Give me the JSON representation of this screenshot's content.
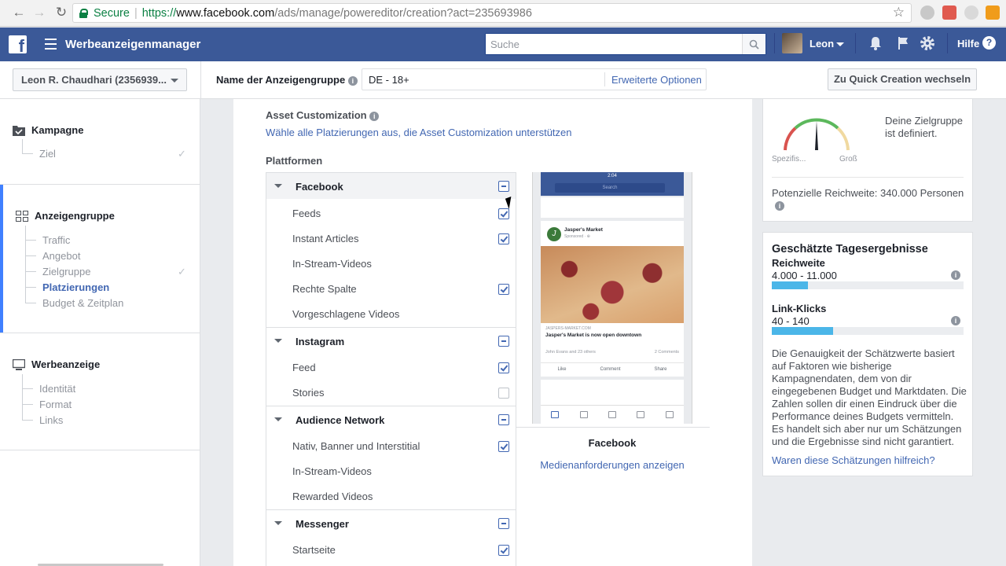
{
  "browser": {
    "secure_label": "Secure",
    "url_scheme": "https://",
    "url_host": "www.facebook.com",
    "url_path": "/ads/manage/powereditor/creation?act=235693986"
  },
  "topbar": {
    "logo": "f",
    "app_title": "Werbeanzeigenmanager",
    "search_placeholder": "Suche",
    "user_name": "Leon",
    "help_label": "Hilfe",
    "help_icon": "?"
  },
  "subheader": {
    "account": "Leon R. Chaudhari (2356939...",
    "adset_name_label": "Name der Anzeigengruppe",
    "adset_name_value": "DE - 18+",
    "advanced_options": "Erweiterte Optionen",
    "quick_creation": "Zu Quick Creation wechseln"
  },
  "sidebar": {
    "campaign": {
      "title": "Kampagne",
      "items": [
        "Ziel"
      ]
    },
    "adset": {
      "title": "Anzeigengruppe",
      "items": [
        "Traffic",
        "Angebot",
        "Zielgruppe",
        "Platzierungen",
        "Budget & Zeitplan"
      ]
    },
    "ad": {
      "title": "Werbeanzeige",
      "items": [
        "Identität",
        "Format",
        "Links"
      ]
    },
    "check": "✓"
  },
  "main": {
    "asset_customization_title": "Asset Customization",
    "asset_customization_link": "Wähle alle Platzierungen aus, die Asset Customization unterstützen",
    "platforms_title": "Plattformen",
    "groups": [
      {
        "label": "Facebook",
        "items": [
          {
            "label": "Feeds",
            "checked": true
          },
          {
            "label": "Instant Articles",
            "checked": true
          },
          {
            "label": "In-Stream-Videos",
            "checked": false
          },
          {
            "label": "Rechte Spalte",
            "checked": true
          },
          {
            "label": "Vorgeschlagene Videos",
            "checked": false
          }
        ]
      },
      {
        "label": "Instagram",
        "items": [
          {
            "label": "Feed",
            "checked": true
          },
          {
            "label": "Stories",
            "checked": false
          }
        ]
      },
      {
        "label": "Audience Network",
        "items": [
          {
            "label": "Nativ, Banner und Interstitial",
            "checked": true
          },
          {
            "label": "In-Stream-Videos",
            "checked": false
          },
          {
            "label": "Rewarded Videos",
            "checked": false
          }
        ]
      },
      {
        "label": "Messenger",
        "items": [
          {
            "label": "Startseite",
            "checked": true
          }
        ]
      }
    ],
    "preview": {
      "status_time": "2:04",
      "search": "Search",
      "page_name": "Jasper's Market",
      "sponsored": "Sponsored · ⊕",
      "domain": "JASPERS-MARKET.COM",
      "headline": "Jasper's Market is now open downtown",
      "reactions": "John Evans and 23 others",
      "comments": "2 Comments",
      "like": "Like",
      "comment": "Comment",
      "share": "Share",
      "label": "Facebook",
      "media_link": "Medienanforderungen anzeigen"
    }
  },
  "audience": {
    "spec_label": "Spezifis...",
    "broad_label": "Groß",
    "defined": "Deine Zielgruppe ist definiert.",
    "potential_reach": "Potenzielle Reichweite: 340.000 Personen",
    "info_icon": "i"
  },
  "estimates": {
    "title": "Geschätzte Tagesergebnisse",
    "reach_label": "Reichweite",
    "reach_value": "4.000 - 11.000",
    "reach_fill": 0.19,
    "clicks_label": "Link-Klicks",
    "clicks_value": "40 - 140",
    "clicks_fill": 0.32,
    "description": "Die Genauigkeit der Schätzwerte basiert auf Faktoren wie bisherige Kampagnendaten, dem von dir eingegebenen Budget und Marktdaten. Die Zahlen sollen dir einen Eindruck über die Performance deines Budgets vermitteln. Es handelt sich aber nur um Schätzungen und die Ergebnisse sind nicht garantiert.",
    "feedback_link": "Waren diese Schätzungen hilfreich?"
  }
}
